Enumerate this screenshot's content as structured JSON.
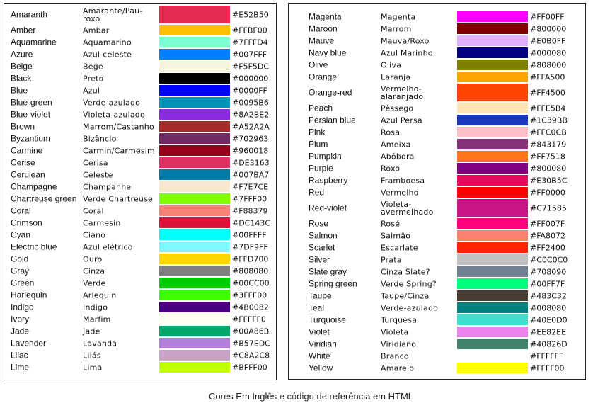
{
  "left": [
    {
      "en": "Amaranth",
      "pt": "Amarante/Pau-roxo",
      "hex": "#E52B50",
      "tall": true
    },
    {
      "en": "Amber",
      "pt": "Ambar",
      "hex": "#FFBF00"
    },
    {
      "en": "Aquamarine",
      "pt": "Aquamarino",
      "hex": "#7FFFD4"
    },
    {
      "en": "Azure",
      "pt": "Azul-celeste",
      "hex": "#007FFF"
    },
    {
      "en": "Beige",
      "pt": "Bege",
      "hex": "#F5F5DC"
    },
    {
      "en": "Black",
      "pt": "Preto",
      "hex": "#000000"
    },
    {
      "en": "Blue",
      "pt": "Azul",
      "hex": "#0000FF"
    },
    {
      "en": "Blue-green",
      "pt": "Verde-azulado",
      "hex": "#0095B6"
    },
    {
      "en": "Blue-violet",
      "pt": "Violeta-azulado",
      "hex": "#8A2BE2"
    },
    {
      "en": "Brown",
      "pt": "Marrom/Castanho",
      "hex": "#A52A2A"
    },
    {
      "en": "Byzantium",
      "pt": "Bizâncio",
      "hex": "#702963"
    },
    {
      "en": "Carmine",
      "pt": "Carmin/Carmesim",
      "hex": "#960018"
    },
    {
      "en": "Cerise",
      "pt": "Cerisa",
      "hex": "#DE3163"
    },
    {
      "en": "Cerulean",
      "pt": "Celeste",
      "hex": "#007BA7"
    },
    {
      "en": "Champagne",
      "pt": "Champanhe",
      "hex": "#F7E7CE"
    },
    {
      "en": "Chartreuse green",
      "pt": "Verde Chartreuse",
      "hex": "#7FFF00"
    },
    {
      "en": "Coral",
      "pt": "Coral",
      "hex": "#F88379"
    },
    {
      "en": "Crimson",
      "pt": "Carmesin",
      "hex": "#DC143C"
    },
    {
      "en": "Cyan",
      "pt": "Ciano",
      "hex": "#00FFFF"
    },
    {
      "en": "Electric blue",
      "pt": "Azul elétrico",
      "hex": "#7DF9FF"
    },
    {
      "en": "Gold",
      "pt": "Ouro",
      "hex": "#FFD700"
    },
    {
      "en": "Gray",
      "pt": "Cinza",
      "hex": "#808080"
    },
    {
      "en": "Green",
      "pt": "Verde",
      "hex": "#00CC00"
    },
    {
      "en": "Harlequin",
      "pt": "Arlequin",
      "hex": "#3FFF00"
    },
    {
      "en": "Indigo",
      "pt": "Indigo",
      "hex": "#4B0082"
    },
    {
      "en": "Ivory",
      "pt": "Marfim",
      "hex": "#FFFFF0"
    },
    {
      "en": "Jade",
      "pt": "Jade",
      "hex": "#00A86B"
    },
    {
      "en": "Lavender",
      "pt": "Lavanda",
      "hex": "#B57EDC"
    },
    {
      "en": "Lilac",
      "pt": "Lilás",
      "hex": "#C8A2C8"
    },
    {
      "en": "Lime",
      "pt": "Lima",
      "hex": "#BFFF00"
    }
  ],
  "right": [
    {
      "en": "Magenta",
      "pt": "Magenta",
      "hex": "#FF00FF"
    },
    {
      "en": "Maroon",
      "pt": "Marrom",
      "hex": "#800000"
    },
    {
      "en": "Mauve",
      "pt": "Mauva/Roxo",
      "hex": "#E0B0FF"
    },
    {
      "en": "Navy blue",
      "pt": "Azul Marinho",
      "hex": "#000080"
    },
    {
      "en": "Olive",
      "pt": "Oliva",
      "hex": "#808000"
    },
    {
      "en": "Orange",
      "pt": "Laranja",
      "hex": "#FFA500"
    },
    {
      "en": "Orange-red",
      "pt": "Vermelho-alaranjado",
      "hex": "#FF4500",
      "tall": true
    },
    {
      "en": "Peach",
      "pt": "Pêssego",
      "hex": "#FFE5B4"
    },
    {
      "en": "Persian blue",
      "pt": "Azul Persa",
      "hex": "#1C39BB"
    },
    {
      "en": "Pink",
      "pt": "Rosa",
      "hex": "#FFC0CB"
    },
    {
      "en": "Plum",
      "pt": "Ameixa",
      "hex": "#843179"
    },
    {
      "en": "Pumpkin",
      "pt": "Abóbora",
      "hex": "#FF7518"
    },
    {
      "en": "Purple",
      "pt": "Roxo",
      "hex": "#800080"
    },
    {
      "en": "Raspberry",
      "pt": "Framboesa",
      "hex": "#E30B5C"
    },
    {
      "en": "Red",
      "pt": "Vermelho",
      "hex": "#FF0000"
    },
    {
      "en": "Red-violet",
      "pt": "Violeta-avermelhado",
      "hex": "#C71585",
      "tall": true
    },
    {
      "en": "Rose",
      "pt": "Rosé",
      "hex": "#FF007F"
    },
    {
      "en": "Salmon",
      "pt": "Salmão",
      "hex": "#FA8072"
    },
    {
      "en": "Scarlet",
      "pt": "Escarlate",
      "hex": "#FF2400"
    },
    {
      "en": "Silver",
      "pt": "Prata",
      "hex": "#C0C0C0"
    },
    {
      "en": "Slate gray",
      "pt": "Cinza Slate?",
      "hex": "#708090"
    },
    {
      "en": "Spring green",
      "pt": "Verde Spring?",
      "hex": "#00FF7F"
    },
    {
      "en": "Taupe",
      "pt": "Taupe/Cinza",
      "hex": "#483C32"
    },
    {
      "en": "Teal",
      "pt": "Verde-azulado",
      "hex": "#008080"
    },
    {
      "en": "Turquoise",
      "pt": "Turquesa",
      "hex": "#40E0D0"
    },
    {
      "en": "Violet",
      "pt": "Violeta",
      "hex": "#EE82EE"
    },
    {
      "en": "Viridian",
      "pt": "Viridiano",
      "hex": "#40826D"
    },
    {
      "en": "White",
      "pt": "Branco",
      "hex": "#FFFFFF"
    },
    {
      "en": "Yellow",
      "pt": "Amarelo",
      "hex": "#FFFF00"
    }
  ],
  "caption": "Cores Em Inglês  e código de referência em HTML"
}
